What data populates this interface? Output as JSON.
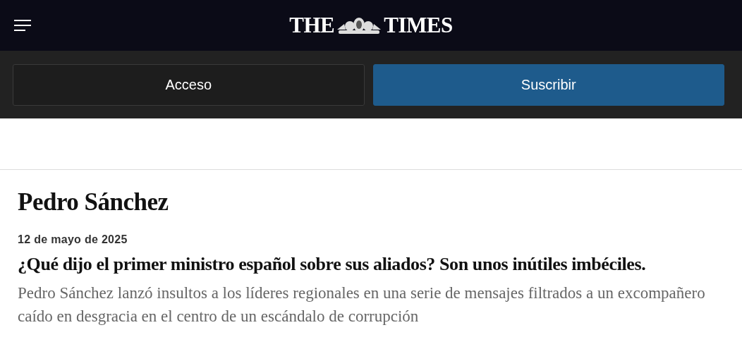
{
  "masthead": {
    "logo_left": "THE",
    "logo_right": "TIMES"
  },
  "account_buttons": [
    {
      "label": "Acceso",
      "kind": "secondary"
    },
    {
      "label": "Suscribir",
      "kind": "primary"
    }
  ],
  "topic": {
    "title": "Pedro Sánchez"
  },
  "articles": [
    {
      "date": "12 de mayo de 2025",
      "headline": "¿Qué dijo el primer ministro español sobre sus aliados? Son unos inútiles imbéciles.",
      "summary": "Pedro Sánchez lanzó insultos a los líderes regionales en una serie de mensajes filtrados a un excompañero caído en desgracia en el centro de un escándalo de corrupción"
    }
  ]
}
